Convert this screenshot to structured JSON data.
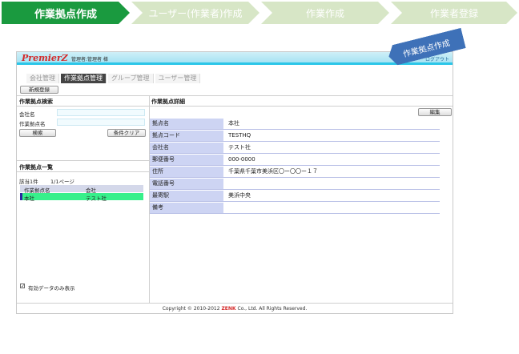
{
  "steps": [
    {
      "label": "作業拠点作成"
    },
    {
      "label": "ユーザー(作業者)作成"
    },
    {
      "label": "作業作成"
    },
    {
      "label": "作業者登録"
    }
  ],
  "ribbon": "作業拠点作成",
  "header": {
    "logo": "PremierZ",
    "user": "管理者:管理者 様",
    "right": "ログアウト"
  },
  "tabs": [
    "会社管理",
    "作業拠点管理",
    "グループ管理",
    "ユーザー管理"
  ],
  "new_button": "新規登録",
  "search": {
    "title": "作業拠点検索",
    "company_label": "会社名",
    "site_label": "作業拠点名",
    "search_button": "検索",
    "clear_button": "条件クリア"
  },
  "list": {
    "title": "作業拠点一覧",
    "count": "該当1件",
    "page": "1/1ページ",
    "columns": [
      "作業拠点名",
      "会社"
    ],
    "rows": [
      {
        "name": "本社",
        "company": "テスト社"
      }
    ]
  },
  "active_only_label": "有効データのみ表示",
  "detail": {
    "title": "作業拠点詳細",
    "edit_button": "編集",
    "rows": [
      {
        "label": "拠点名",
        "value": "本社"
      },
      {
        "label": "拠点コード",
        "value": "TESTHQ"
      },
      {
        "label": "会社名",
        "value": "テスト社"
      },
      {
        "label": "郵便番号",
        "value": "000-0000"
      },
      {
        "label": "住所",
        "value": "千葉県千葉市美浜区〇ー〇〇ー１７"
      },
      {
        "label": "電話番号",
        "value": ""
      },
      {
        "label": "最寄駅",
        "value": "美浜中央"
      },
      {
        "label": "備考",
        "value": ""
      }
    ]
  },
  "footer": {
    "prefix": "Copyright © 2010-2012",
    "brand": "ZENK",
    "suffix": "Co., Ltd. All Rights Reserved."
  }
}
